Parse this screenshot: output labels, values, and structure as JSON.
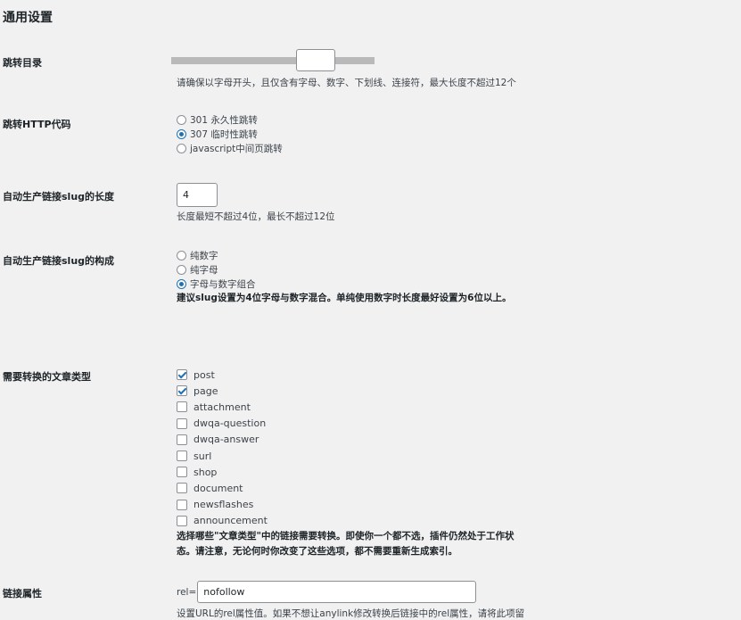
{
  "page_title": "通用设置",
  "redirect_dir": {
    "label": "跳转目录",
    "desc": "请确保以字母开头，且仅含有字母、数字、下划线、连接符，最大长度不超过12个"
  },
  "http_code": {
    "label": "跳转HTTP代码",
    "options": [
      {
        "label": "301 永久性跳转",
        "checked": false
      },
      {
        "label": "307 临时性跳转",
        "checked": true
      },
      {
        "label": "javascript中间页跳转",
        "checked": false
      }
    ]
  },
  "slug_length": {
    "label": "自动生产链接slug的长度",
    "value": "4",
    "desc": "长度最短不超过4位，最长不超过12位"
  },
  "slug_composition": {
    "label": "自动生产链接slug的构成",
    "options": [
      {
        "label": "纯数字",
        "checked": false
      },
      {
        "label": "纯字母",
        "checked": false
      },
      {
        "label": "字母与数字组合",
        "checked": true
      }
    ],
    "desc": "建议slug设置为4位字母与数字混合。单纯使用数字时长度最好设置为6位以上。"
  },
  "post_types": {
    "label": "需要转换的文章类型",
    "items": [
      {
        "label": "post",
        "checked": true
      },
      {
        "label": "page",
        "checked": true
      },
      {
        "label": "attachment",
        "checked": false
      },
      {
        "label": "dwqa-question",
        "checked": false
      },
      {
        "label": "dwqa-answer",
        "checked": false
      },
      {
        "label": "surl",
        "checked": false
      },
      {
        "label": "shop",
        "checked": false
      },
      {
        "label": "document",
        "checked": false
      },
      {
        "label": "newsflashes",
        "checked": false
      },
      {
        "label": "announcement",
        "checked": false
      }
    ],
    "desc_line1": "选择哪些\"文章类型\"中的链接需要转换。即使你一个都不选，插件仍然处于工作状",
    "desc_line2": "态。请注意，无论何时你改变了这些选项，都不需要重新生成索引。"
  },
  "link_attr": {
    "label": "链接属性",
    "prefix": "rel=",
    "value": "nofollow",
    "desc": "设置URL的rel属性值。如果不想让anylink修改转换后链接中的rel属性，请将此项留"
  }
}
